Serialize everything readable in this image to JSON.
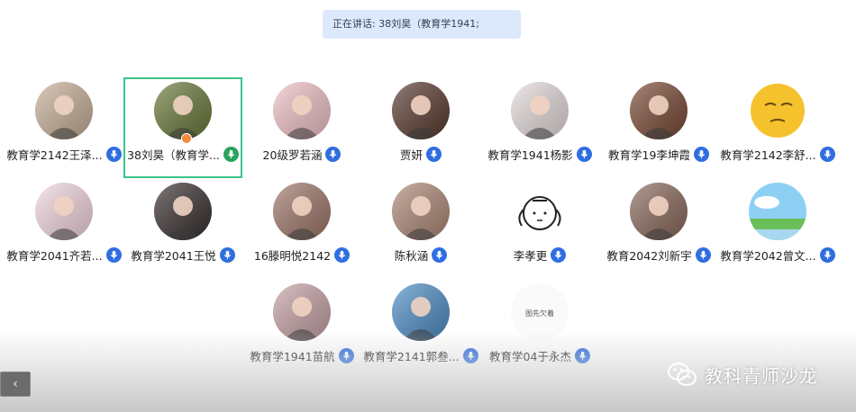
{
  "speaker_banner": {
    "text": "正在讲话: 38刘昊（教育学1941;"
  },
  "participants": [
    {
      "name": "教育学2142王泽...",
      "mic": "blue",
      "avatar": "avatar-cat-photo",
      "color": "#c9b29a"
    },
    {
      "name": "38刘昊（教育学...",
      "mic": "green",
      "avatar": "avatar-person-green-jacket",
      "color": "#6b7a3a",
      "active": true
    },
    {
      "name": "20级罗若涵",
      "mic": "blue",
      "avatar": "avatar-cartoon-ghost",
      "color": "#f2c3c8"
    },
    {
      "name": "贾妍",
      "mic": "blue",
      "avatar": "avatar-woman-portrait",
      "color": "#5a3b30"
    },
    {
      "name": "教育学1941杨影",
      "mic": "blue",
      "avatar": "avatar-woman-red-lips",
      "color": "#e8dede"
    },
    {
      "name": "教育学19李坤霞",
      "mic": "blue",
      "avatar": "avatar-woman-drinking",
      "color": "#7a4a35"
    },
    {
      "name": "教育学2142李舒...",
      "mic": "blue",
      "avatar": "avatar-emoji-face",
      "color": "#f4c430"
    },
    {
      "name": "教育学2041齐若...",
      "mic": "blue",
      "avatar": "avatar-anime-girl",
      "color": "#f6d9e2"
    },
    {
      "name": "教育学2041王悦",
      "mic": "blue",
      "avatar": "avatar-woman-hat",
      "color": "#3a3030"
    },
    {
      "name": "16滕明悦2142",
      "mic": "blue",
      "avatar": "avatar-illustration-girls",
      "color": "#a0786a"
    },
    {
      "name": "陈秋涵",
      "mic": "blue",
      "avatar": "avatar-girl-flowers",
      "color": "#b08a78"
    },
    {
      "name": "李孝更",
      "mic": "blue",
      "avatar": "avatar-doodle-girl",
      "color": "#ffffff"
    },
    {
      "name": "教育2042刘新宇",
      "mic": "blue",
      "avatar": "avatar-woman-selfie",
      "color": "#8c6a5c"
    },
    {
      "name": "教育学2042曾文...",
      "mic": "blue",
      "avatar": "avatar-anime-landscape",
      "color": "#8ccaf0"
    },
    {
      "name": "教育学1941苗航",
      "mic": "blue",
      "avatar": "avatar-person-sunset",
      "color": "#c8a4a8"
    },
    {
      "name": "教育学2141郭叁...",
      "mic": "blue",
      "avatar": "avatar-woman-blue-cap",
      "color": "#4f8fc8"
    },
    {
      "name": "教育学04于永杰",
      "mic": "blue",
      "avatar": "avatar-placeholder",
      "color": "#ffffff",
      "placeholder": "图先欠着"
    }
  ],
  "nav": {
    "prev_label": "‹"
  },
  "watermark": {
    "text": "教科青师沙龙"
  }
}
